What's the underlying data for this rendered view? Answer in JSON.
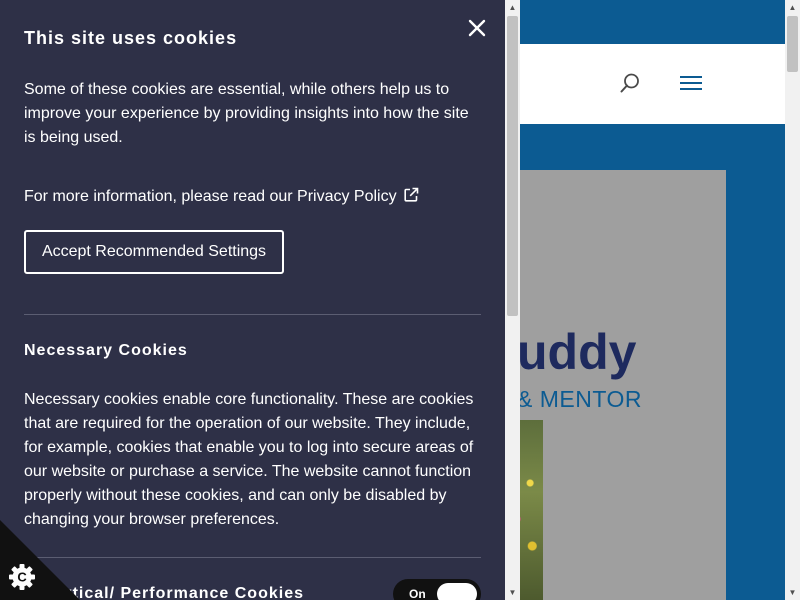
{
  "site": {
    "heading_partial": "uddy",
    "subheading_partial": "& MENTOR"
  },
  "cookie_panel": {
    "title": "This site uses cookies",
    "intro": "Some of these cookies are essential, while others help us to improve your experience by providing insights into how the site is being used.",
    "privacy_prefix": "For more information, please read our ",
    "privacy_link": "Privacy Policy",
    "accept_label": "Accept Recommended Settings",
    "necessary": {
      "title": "Necessary Cookies",
      "text": "Necessary cookies enable core functionality. These are cookies that are required for the operation of our website. They include, for example, cookies that enable you to log into secure areas of our website or purchase a service. The website cannot function properly without these cookies, and can only be disabled by changing your browser preferences."
    },
    "analytics": {
      "title": "Analytical/ Performance Cookies",
      "toggle_label": "On"
    }
  },
  "icons": {
    "close": "close-icon",
    "external_link": "external-link-icon",
    "search": "search-icon",
    "menu": "hamburger-menu-icon",
    "cookie_badge": "cookie-icon"
  },
  "colors": {
    "panel_bg": "#2e3047",
    "site_blue": "#0c5b92",
    "heading_navy": "#1e2a5e"
  }
}
